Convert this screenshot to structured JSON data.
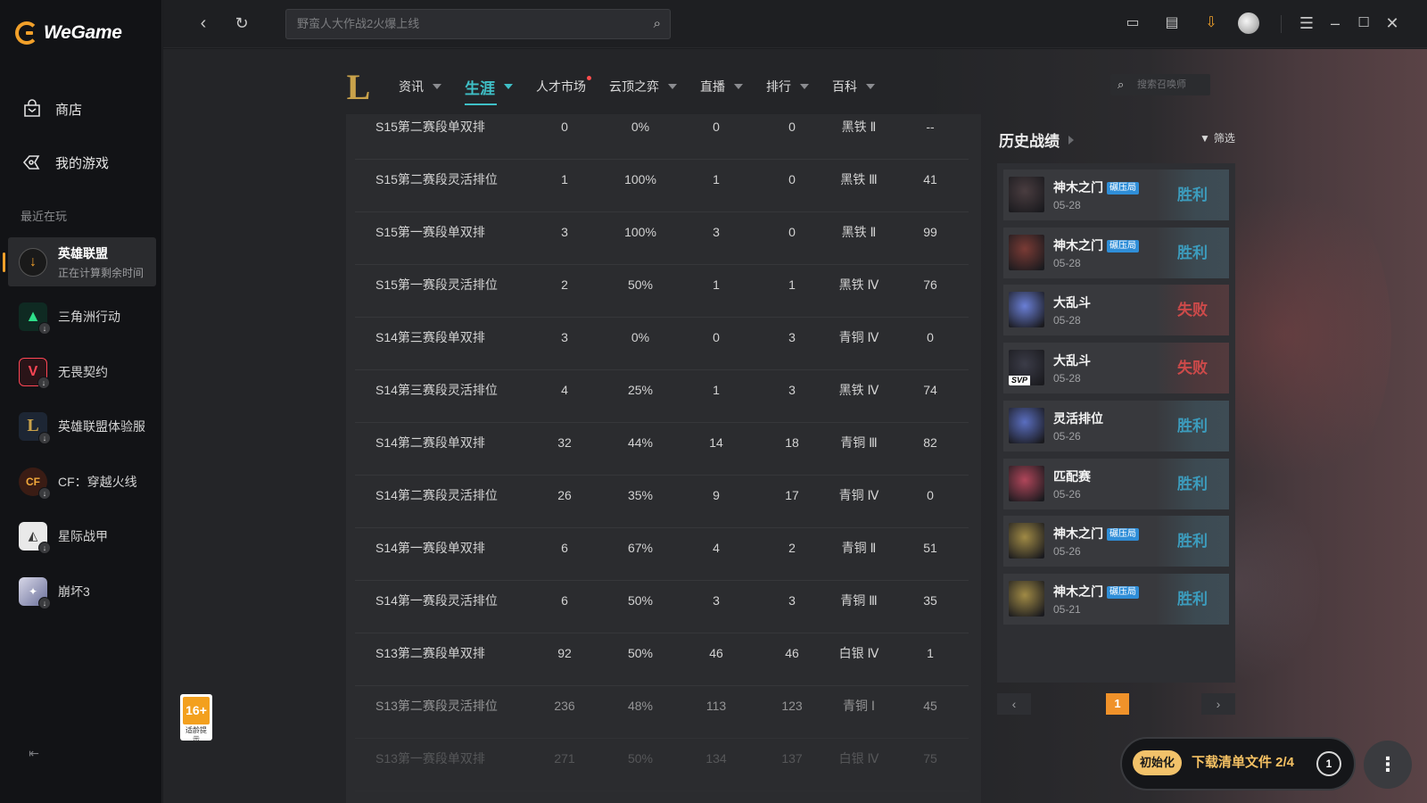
{
  "app": {
    "logo_text": "WeGame"
  },
  "sidebar": {
    "nav": [
      {
        "label": "商店",
        "icon": "store-icon"
      },
      {
        "label": "我的游戏",
        "icon": "my-games-icon"
      }
    ],
    "recent_label": "最近在玩",
    "games": [
      {
        "name": "英雄联盟",
        "sub": "正在计算剩余时间",
        "active": true
      },
      {
        "name": "三角洲行动"
      },
      {
        "name": "无畏契约"
      },
      {
        "name": "英雄联盟体验服"
      },
      {
        "name": "CF：穿越火线"
      },
      {
        "name": "星际战甲"
      },
      {
        "name": "崩坏3"
      }
    ]
  },
  "topbar": {
    "search_placeholder": "野蛮人大作战2火爆上线"
  },
  "game_nav": {
    "logo_letter": "L",
    "tabs": [
      {
        "label": "资讯"
      },
      {
        "label": "生涯",
        "active": true
      },
      {
        "label": "人才市场"
      },
      {
        "label": "云顶之弈"
      },
      {
        "label": "直播"
      },
      {
        "label": "排行"
      },
      {
        "label": "百科"
      }
    ],
    "search_placeholder": "搜索召唤师"
  },
  "seasons": [
    {
      "name": "S15第二赛段单双排",
      "games": "0",
      "winrate": "0%",
      "wins": "0",
      "losses": "0",
      "rank": "黑铁 Ⅱ",
      "points": "--"
    },
    {
      "name": "S15第二赛段灵活排位",
      "games": "1",
      "winrate": "100%",
      "wins": "1",
      "losses": "0",
      "rank": "黑铁 Ⅲ",
      "points": "41"
    },
    {
      "name": "S15第一赛段单双排",
      "games": "3",
      "winrate": "100%",
      "wins": "3",
      "losses": "0",
      "rank": "黑铁 Ⅱ",
      "points": "99"
    },
    {
      "name": "S15第一赛段灵活排位",
      "games": "2",
      "winrate": "50%",
      "wins": "1",
      "losses": "1",
      "rank": "黑铁 Ⅳ",
      "points": "76"
    },
    {
      "name": "S14第三赛段单双排",
      "games": "3",
      "winrate": "0%",
      "wins": "0",
      "losses": "3",
      "rank": "青铜 Ⅳ",
      "points": "0"
    },
    {
      "name": "S14第三赛段灵活排位",
      "games": "4",
      "winrate": "25%",
      "wins": "1",
      "losses": "3",
      "rank": "黑铁 Ⅳ",
      "points": "74"
    },
    {
      "name": "S14第二赛段单双排",
      "games": "32",
      "winrate": "44%",
      "wins": "14",
      "losses": "18",
      "rank": "青铜 Ⅲ",
      "points": "82"
    },
    {
      "name": "S14第二赛段灵活排位",
      "games": "26",
      "winrate": "35%",
      "wins": "9",
      "losses": "17",
      "rank": "青铜 Ⅳ",
      "points": "0"
    },
    {
      "name": "S14第一赛段单双排",
      "games": "6",
      "winrate": "67%",
      "wins": "4",
      "losses": "2",
      "rank": "青铜 Ⅱ",
      "points": "51"
    },
    {
      "name": "S14第一赛段灵活排位",
      "games": "6",
      "winrate": "50%",
      "wins": "3",
      "losses": "3",
      "rank": "青铜 Ⅲ",
      "points": "35"
    },
    {
      "name": "S13第二赛段单双排",
      "games": "92",
      "winrate": "50%",
      "wins": "46",
      "losses": "46",
      "rank": "白银 Ⅳ",
      "points": "1"
    },
    {
      "name": "S13第二赛段灵活排位",
      "games": "236",
      "winrate": "48%",
      "wins": "113",
      "losses": "123",
      "rank": "青铜 Ⅰ",
      "points": "45"
    },
    {
      "name": "S13第一赛段单双排",
      "games": "271",
      "winrate": "50%",
      "wins": "134",
      "losses": "137",
      "rank": "白银 Ⅳ",
      "points": "75"
    }
  ],
  "history": {
    "title": "历史战绩",
    "filter_label": "筛选",
    "matches": [
      {
        "mode": "神木之门",
        "tag": "碾压局",
        "date": "05-28",
        "result": "胜利",
        "win": true,
        "color": "#4a3d40"
      },
      {
        "mode": "神木之门",
        "tag": "碾压局",
        "date": "05-28",
        "result": "胜利",
        "win": true,
        "color": "#7a3b35"
      },
      {
        "mode": "大乱斗",
        "date": "05-28",
        "result": "失败",
        "win": false,
        "color": "#6a7fd6"
      },
      {
        "mode": "大乱斗",
        "date": "05-28",
        "result": "失败",
        "win": false,
        "color": "#3b3c48",
        "badge": "SVP"
      },
      {
        "mode": "灵活排位",
        "date": "05-26",
        "result": "胜利",
        "win": true,
        "color": "#5a6ec0"
      },
      {
        "mode": "匹配赛",
        "date": "05-26",
        "result": "胜利",
        "win": true,
        "color": "#b0465a"
      },
      {
        "mode": "神木之门",
        "tag": "碾压局",
        "date": "05-26",
        "result": "胜利",
        "win": true,
        "color": "#a08a45"
      },
      {
        "mode": "神木之门",
        "tag": "碾压局",
        "date": "05-21",
        "result": "胜利",
        "win": true,
        "color": "#a08a45"
      }
    ],
    "pager": {
      "prev": "‹",
      "current": "1",
      "next": "›"
    }
  },
  "age_rating": {
    "label": "16+",
    "sub": "适龄提示"
  },
  "download": {
    "status": "初始化",
    "text": "下载清单文件 2/4",
    "count": "1"
  },
  "colors": {
    "accent": "#3fc0c7",
    "brand": "#f1a02a",
    "win": "#3c9cbd",
    "lose": "#cd4a4a"
  }
}
